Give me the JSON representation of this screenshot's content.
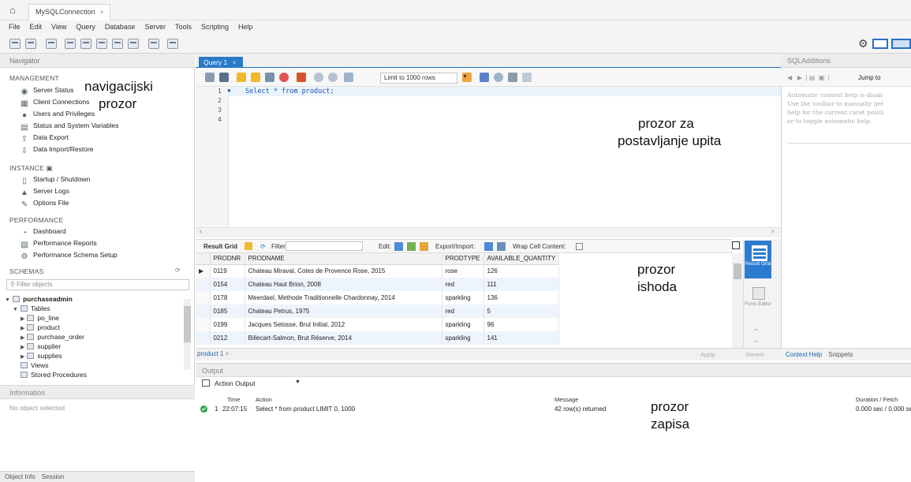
{
  "window": {
    "tab_title": "MySQLConnection",
    "tab_close": "×"
  },
  "menu": [
    "File",
    "Edit",
    "View",
    "Query",
    "Database",
    "Server",
    "Tools",
    "Scripting",
    "Help"
  ],
  "navigator": {
    "header": "Navigator",
    "management_title": "MANAGEMENT",
    "management_items": [
      "Server Status",
      "Client Connections",
      "Users and Privileges",
      "Status and System Variables",
      "Data Export",
      "Data Import/Restore"
    ],
    "instance_title": "INSTANCE",
    "instance_items": [
      "Startup / Shutdown",
      "Server Logs",
      "Options File"
    ],
    "performance_title": "PERFORMANCE",
    "performance_items": [
      "Dashboard",
      "Performance Reports",
      "Performance Schema Setup"
    ],
    "schemas_title": "SCHEMAS",
    "filter_placeholder": "Filter objects",
    "schema_name": "purchaseadmin",
    "tables_label": "Tables",
    "tables": [
      "po_line",
      "product",
      "purchase_order",
      "supplier",
      "supplies"
    ],
    "views_label": "Views",
    "procedures_label": "Stored Procedures"
  },
  "information": {
    "header": "Information",
    "empty_text": "No object selected",
    "tabs": [
      "Object Info",
      "Session"
    ]
  },
  "query": {
    "tab_label": "Query 1",
    "tab_close": "×",
    "limit_label": "Limit to 1000 rows",
    "line_numbers": [
      "1",
      "2",
      "3",
      "4"
    ],
    "sql": "Select * from product;"
  },
  "result": {
    "result_grid_label": "Result Grid",
    "filter_rows_label": "Filter Rows:",
    "edit_label": "Edit:",
    "export_label": "Export/Import:",
    "wrap_label": "Wrap Cell Content:",
    "columns": [
      "PRODNR",
      "PRODNAME",
      "PRODTYPE",
      "AVAILABLE_QUANTITY"
    ],
    "rows": [
      [
        "0119",
        "Chateau Miraval, Cotes de Provence Rose, 2015",
        "rose",
        "126"
      ],
      [
        "0154",
        "Chateau Haut Brion, 2008",
        "red",
        "111"
      ],
      [
        "0178",
        "Meerdael, Methode Traditionnelle Chardonnay, 2014",
        "sparkling",
        "136"
      ],
      [
        "0185",
        "Chateau Petrus, 1975",
        "red",
        "5"
      ],
      [
        "0199",
        "Jacques Selosse, Brut Initial, 2012",
        "sparkling",
        "96"
      ],
      [
        "0212",
        "Billecart-Salmon, Brut Réserve, 2014",
        "sparkling",
        "141"
      ]
    ],
    "side_result_grid": "Result Grid",
    "side_form_editor": "Form Editor",
    "result_tab": "product 1",
    "apply": "Apply",
    "revert": "Revert"
  },
  "sql_additions": {
    "header": "SQLAdditions",
    "jump_to": "Jump to",
    "help_lines": [
      "Automatic context help is disab",
      "Use the toolbar to manually get",
      "help for the current caret positi",
      "or to toggle automatic help."
    ],
    "tabs": [
      "Context Help",
      "Snippets"
    ]
  },
  "output": {
    "header": "Output",
    "selector": "Action Output",
    "columns": {
      "time": "Time",
      "action": "Action",
      "message": "Message",
      "duration": "Duration / Fetch"
    },
    "row": {
      "index": "1",
      "time": "22:07:15",
      "action": "Select * from product LIMIT 0, 1000",
      "message": "42 row(s) returned",
      "duration": "0.000 sec / 0.000 se"
    }
  },
  "annotations": {
    "navigator": [
      "navigacijski",
      "prozor"
    ],
    "query": [
      "prozor za",
      "postavljanje upita"
    ],
    "result": [
      "prozor",
      "ishoda"
    ],
    "log": [
      "prozor",
      "zapisa"
    ]
  },
  "colors": {
    "accent_blue": "#2b79c9",
    "ok_green": "#2fa44f",
    "sql_keyword": "#1a55b8"
  }
}
